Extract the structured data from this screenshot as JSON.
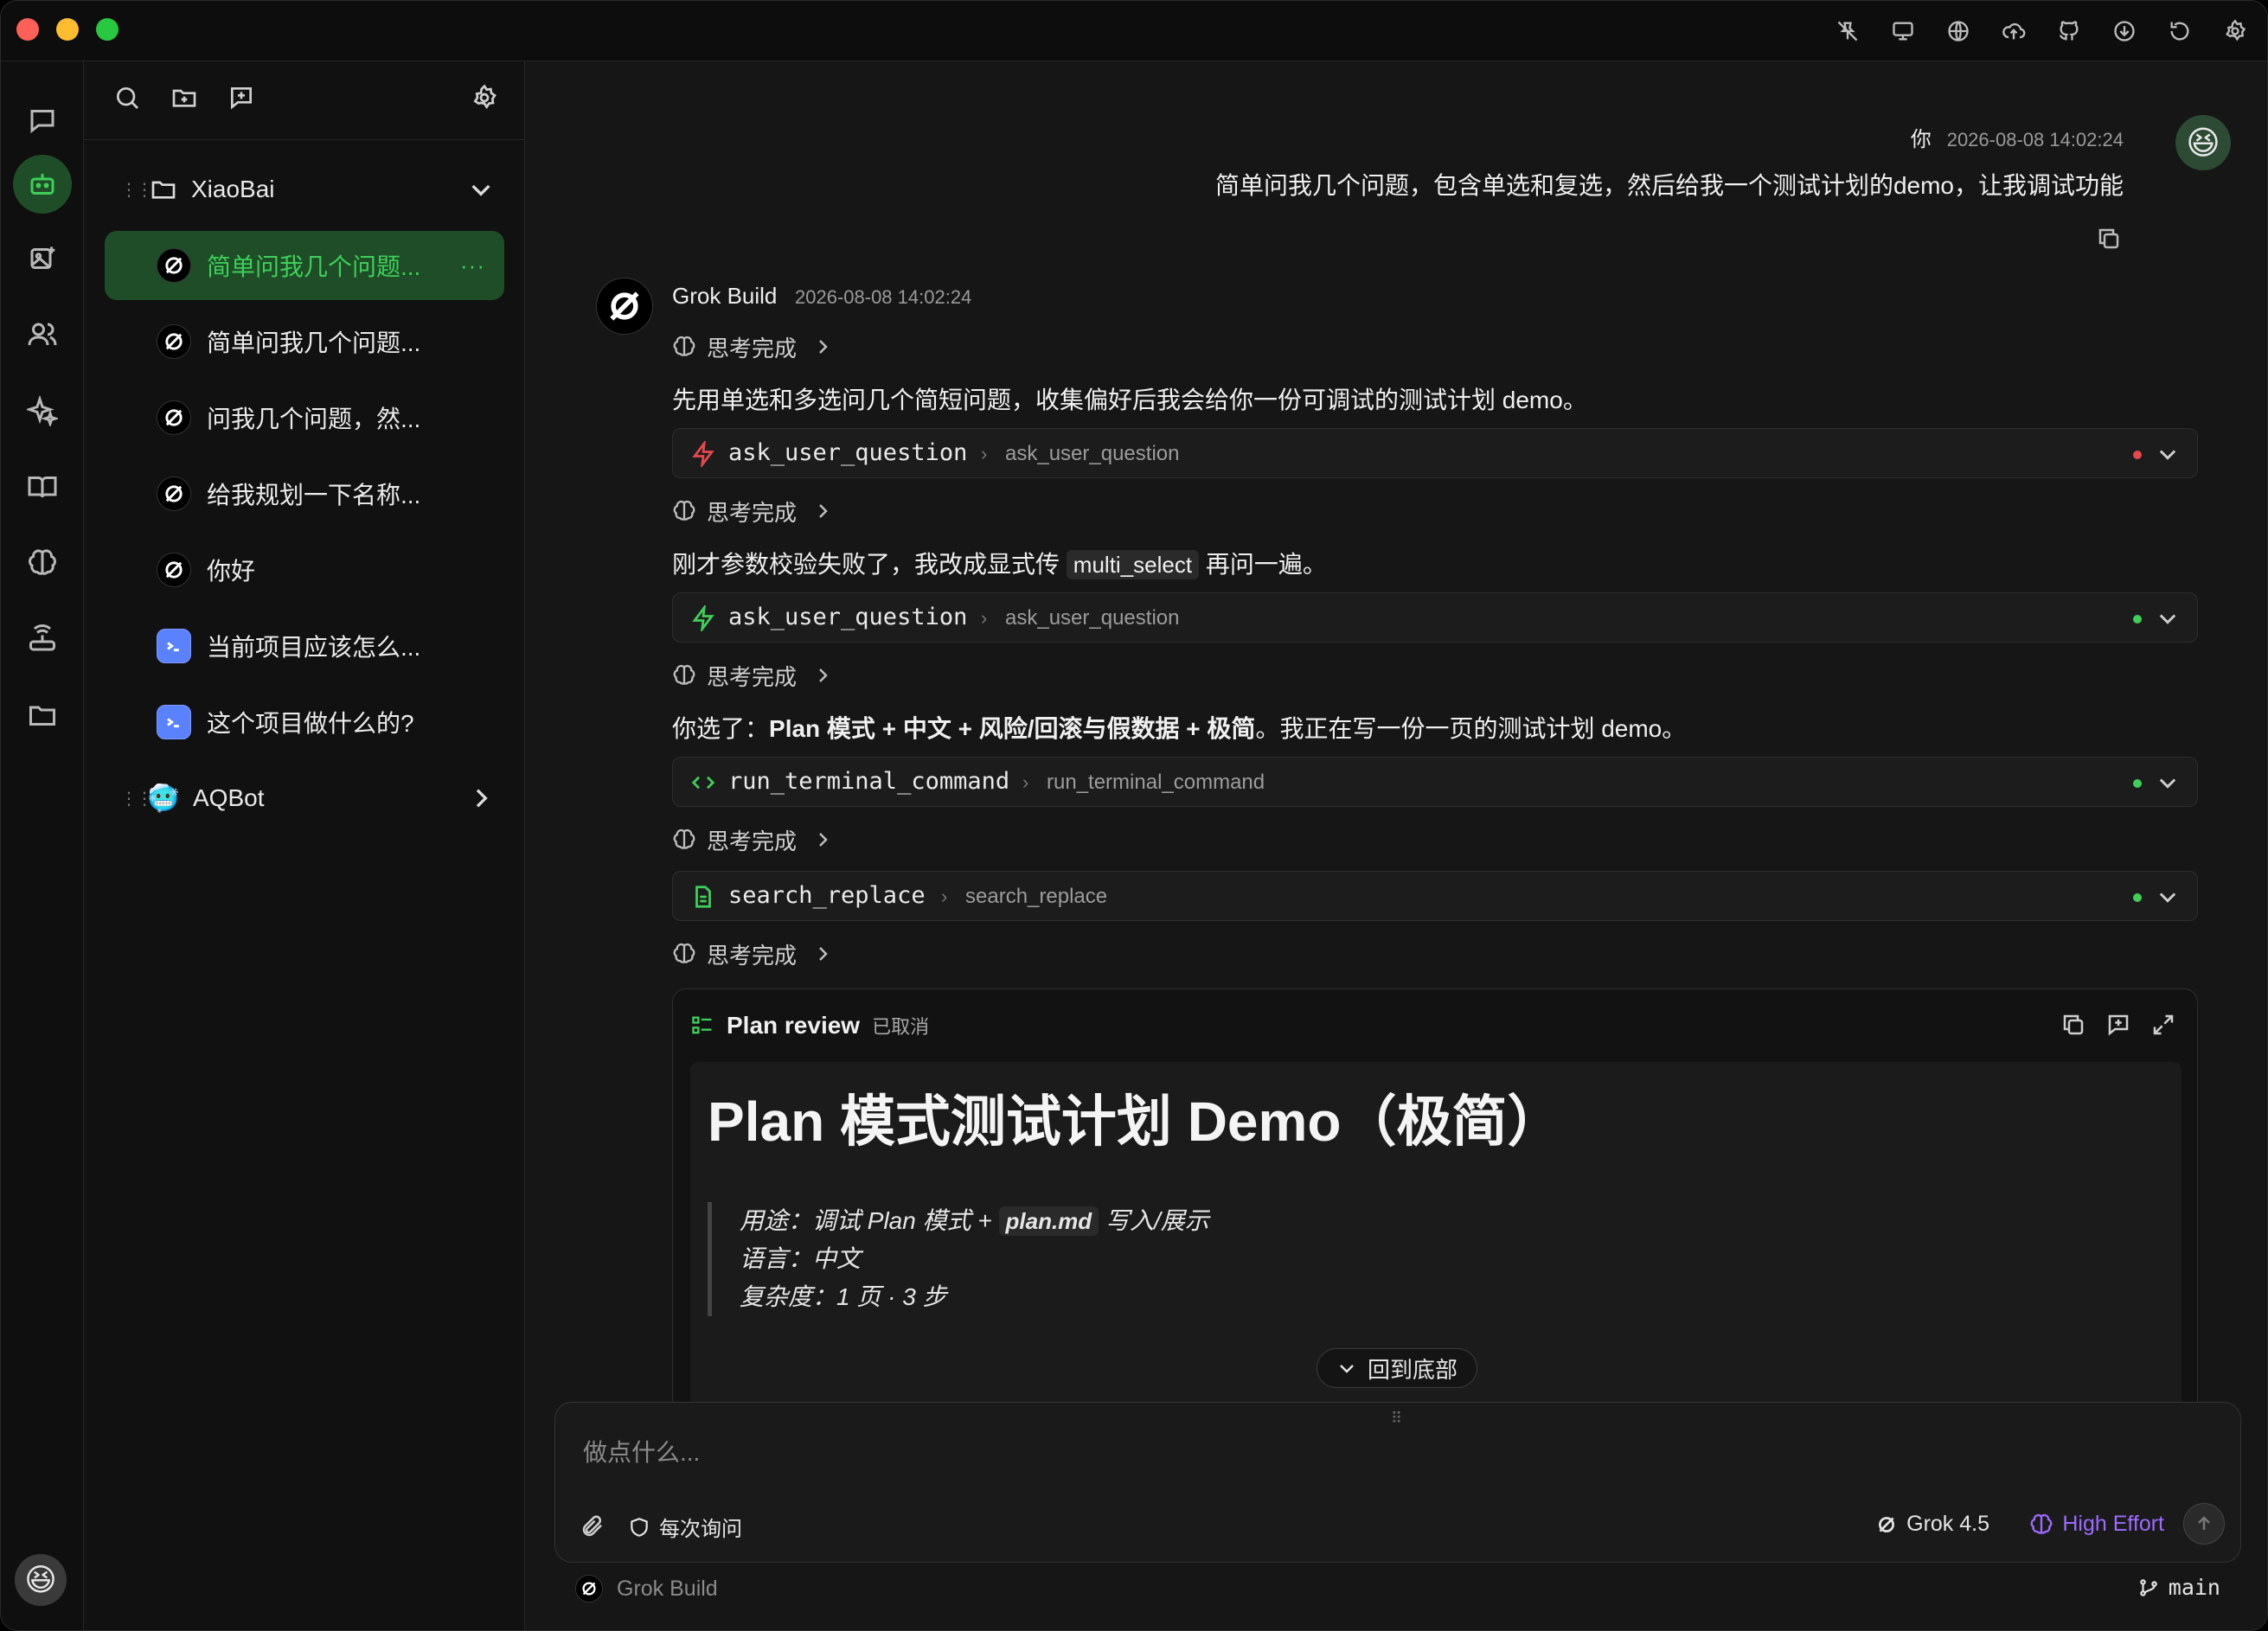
{
  "top_icons": [
    "pin-off-icon",
    "monitor-icon",
    "globe-icon",
    "upload-cloud-icon",
    "github-icon",
    "download-icon",
    "refresh-icon",
    "settings-icon"
  ],
  "sidebar": {
    "groups": [
      {
        "label": "XiaoBai",
        "expanded": true
      },
      {
        "label": "AQBot",
        "expanded": false
      }
    ],
    "chats": [
      {
        "label": "简单问我几个问题...",
        "active": true,
        "icon": "grok-icon"
      },
      {
        "label": "简单问我几个问题...",
        "active": false,
        "icon": "grok-icon"
      },
      {
        "label": "问我几个问题，然...",
        "active": false,
        "icon": "grok-icon"
      },
      {
        "label": "给我规划一下名称...",
        "active": false,
        "icon": "grok-icon"
      },
      {
        "label": "你好",
        "active": false,
        "icon": "grok-icon"
      },
      {
        "label": "当前项目应该怎么...",
        "active": false,
        "icon": "terminal-agent-icon"
      },
      {
        "label": "这个项目做什么的?",
        "active": false,
        "icon": "terminal-agent-icon"
      }
    ],
    "more_label": "···"
  },
  "conversation": {
    "user": {
      "name": "你",
      "time": "2026-08-08 14:02:24",
      "text": "简单问我几个问题，包含单选和复选，然后给我一个测试计划的demo，让我调试功能",
      "avatar": "😆"
    },
    "bot": {
      "name": "Grok Build",
      "time": "2026-08-08 14:02:24",
      "think_label": "思考完成",
      "para1": "先用单选和多选问几个简短问题，收集偏好后我会给你一份可调试的测试计划 demo。",
      "para2_pre": "刚才参数校验失败了，我改成显式传",
      "para2_code": "multi_select",
      "para2_post": "再问一遍。",
      "para3_pre": "你选了：",
      "para3_bold": "Plan 模式 + 中文 + 风险/回滚与假数据 + 极简",
      "para3_post": "。我正在写一份一页的测试计划 demo。",
      "tools": [
        {
          "name": "ask_user_question",
          "sub": "ask_user_question",
          "status": "error",
          "icon": "zap-icon"
        },
        {
          "name": "ask_user_question",
          "sub": "ask_user_question",
          "status": "success",
          "icon": "zap-icon"
        },
        {
          "name": "run_terminal_command",
          "sub": "run_terminal_command",
          "status": "success",
          "icon": "code-icon"
        },
        {
          "name": "search_replace",
          "sub": "search_replace",
          "status": "success",
          "icon": "file-icon"
        }
      ],
      "plan": {
        "title": "Plan review",
        "status": "已取消",
        "heading": "Plan 模式测试计划 Demo（极简）",
        "purpose_pre": "用途：调试 Plan 模式 + ",
        "purpose_code": "plan.md",
        "purpose_post": " 写入/展示",
        "language": "语言：中文",
        "complexity": "复杂度：1 页 · 3 步"
      }
    }
  },
  "back_to_bottom": "回到底部",
  "composer": {
    "placeholder": "做点什么...",
    "ask_mode": "每次询问",
    "model": "Grok 4.5",
    "effort": "High Effort"
  },
  "footer": {
    "agent": "Grok Build",
    "branch": "main"
  },
  "colors": {
    "accent_green": "#3ecf5a",
    "error_red": "#e5484d",
    "effort_purple": "#9d6bff"
  },
  "rail_avatar": "😆"
}
